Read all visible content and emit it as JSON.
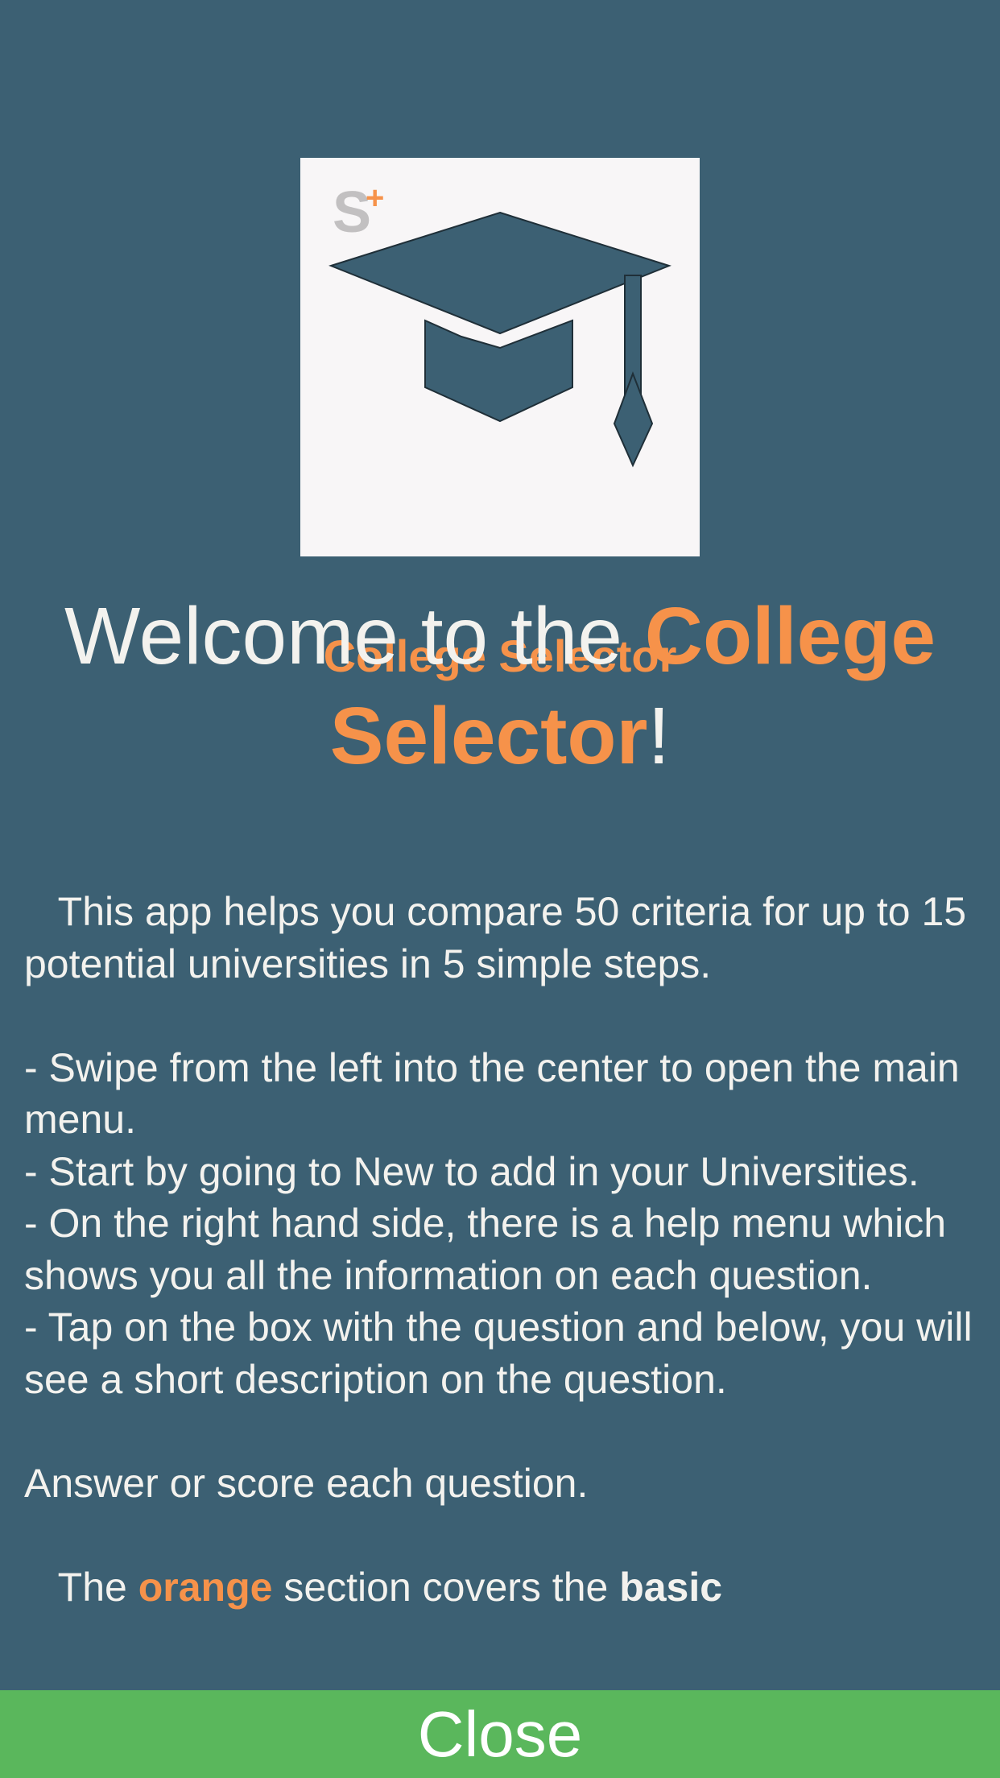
{
  "logo": {
    "icon": "graduation-cap-icon",
    "caption": "College Selector",
    "badge_letter": "S",
    "badge_plus": "+"
  },
  "welcome": {
    "prefix": "Welcome to the ",
    "app_name_line1": "College",
    "app_name_line2": "Selector",
    "suffix": "!"
  },
  "intro": {
    "paragraph1": "   This app helps you compare 50 criteria for up to 15 potential universities in 5 simple steps.",
    "bullets": [
      "- Swipe from the left into the center to open the main menu.",
      "- Start by going to New to add in your Universities.",
      "- On the right hand side, there is a help menu which shows you all the information on each question.",
      "- Tap on the box with the question and below, you will see a short description on the question."
    ],
    "answer_line": "Answer or score each question.",
    "section_prefix": "   The ",
    "section_color_word": "orange",
    "section_middle": " section covers the ",
    "section_bold_word": "basic"
  },
  "close_button": {
    "label": "Close"
  },
  "colors": {
    "background": "#3c6073",
    "accent": "#f6924a",
    "close_bar": "#5ab75c",
    "text": "#f3f2ee"
  }
}
